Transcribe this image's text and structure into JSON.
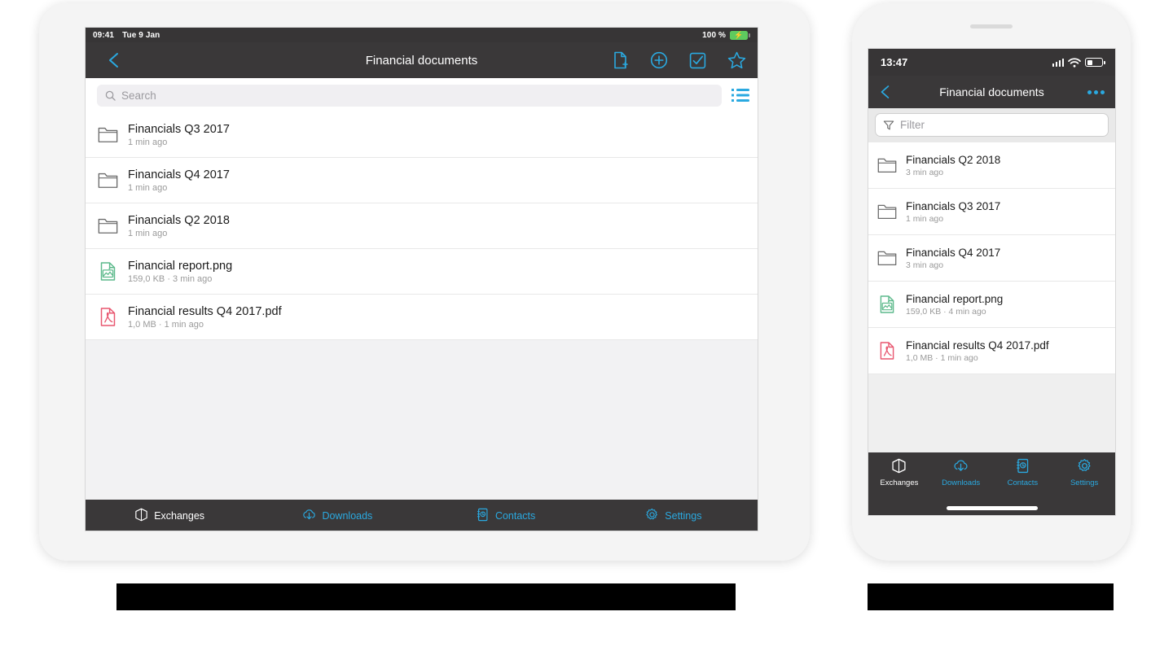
{
  "tablet": {
    "status": {
      "time": "09:41",
      "date": "Tue 9 Jan",
      "battery_percent": "100 %"
    },
    "nav": {
      "back_icon": "chevron-left-icon",
      "title": "Financial documents",
      "actions": [
        {
          "name": "new-document-button",
          "icon": "file-add-icon"
        },
        {
          "name": "add-button",
          "icon": "plus-circle-icon"
        },
        {
          "name": "select-button",
          "icon": "checkbox-check-icon"
        },
        {
          "name": "favorite-button",
          "icon": "star-icon"
        }
      ]
    },
    "search": {
      "placeholder": "Search",
      "value": "",
      "icon": "search-icon"
    },
    "view_toggle": {
      "name": "list-view-toggle",
      "icon": "list-view-icon"
    },
    "items": [
      {
        "type": "folder",
        "name": "Financials Q3 2017",
        "meta": "1 min ago"
      },
      {
        "type": "folder",
        "name": "Financials Q4 2017",
        "meta": "1 min ago"
      },
      {
        "type": "folder",
        "name": "Financials Q2 2018",
        "meta": "1 min ago"
      },
      {
        "type": "png",
        "name": "Financial report.png",
        "meta": "159,0 KB · 3 min ago"
      },
      {
        "type": "pdf",
        "name": "Financial results Q4 2017.pdf",
        "meta": "1,0 MB · 1 min ago"
      }
    ],
    "tabs": [
      {
        "label": "Exchanges",
        "icon": "cube-icon",
        "active": true
      },
      {
        "label": "Downloads",
        "icon": "cloud-down-icon",
        "active": false
      },
      {
        "label": "Contacts",
        "icon": "contacts-icon",
        "active": false
      },
      {
        "label": "Settings",
        "icon": "gear-icon",
        "active": false
      }
    ]
  },
  "phone": {
    "status": {
      "time": "13:47"
    },
    "nav": {
      "back_icon": "chevron-left-icon",
      "title": "Financial documents",
      "more_label": "•••"
    },
    "filter": {
      "placeholder": "Filter",
      "value": "",
      "icon": "funnel-icon"
    },
    "items": [
      {
        "type": "folder",
        "name": "Financials Q2 2018",
        "meta": "3 min ago"
      },
      {
        "type": "folder",
        "name": "Financials Q3 2017",
        "meta": "1 min ago"
      },
      {
        "type": "folder",
        "name": "Financials Q4 2017",
        "meta": "3 min ago"
      },
      {
        "type": "png",
        "name": "Financial report.png",
        "meta": "159,0 KB · 4 min ago"
      },
      {
        "type": "pdf",
        "name": "Financial results Q4 2017.pdf",
        "meta": "1,0 MB · 1 min ago"
      }
    ],
    "tabs": [
      {
        "label": "Exchanges",
        "icon": "cube-icon",
        "active": true
      },
      {
        "label": "Downloads",
        "icon": "cloud-down-icon",
        "active": false
      },
      {
        "label": "Contacts",
        "icon": "contacts-icon",
        "active": false
      },
      {
        "label": "Settings",
        "icon": "gear-icon",
        "active": false
      }
    ]
  },
  "colors": {
    "accent": "#2aa9e0",
    "bar": "#3a3839",
    "folder": "#6b6b6b",
    "png": "#5cb98b",
    "pdf": "#e8566f"
  }
}
